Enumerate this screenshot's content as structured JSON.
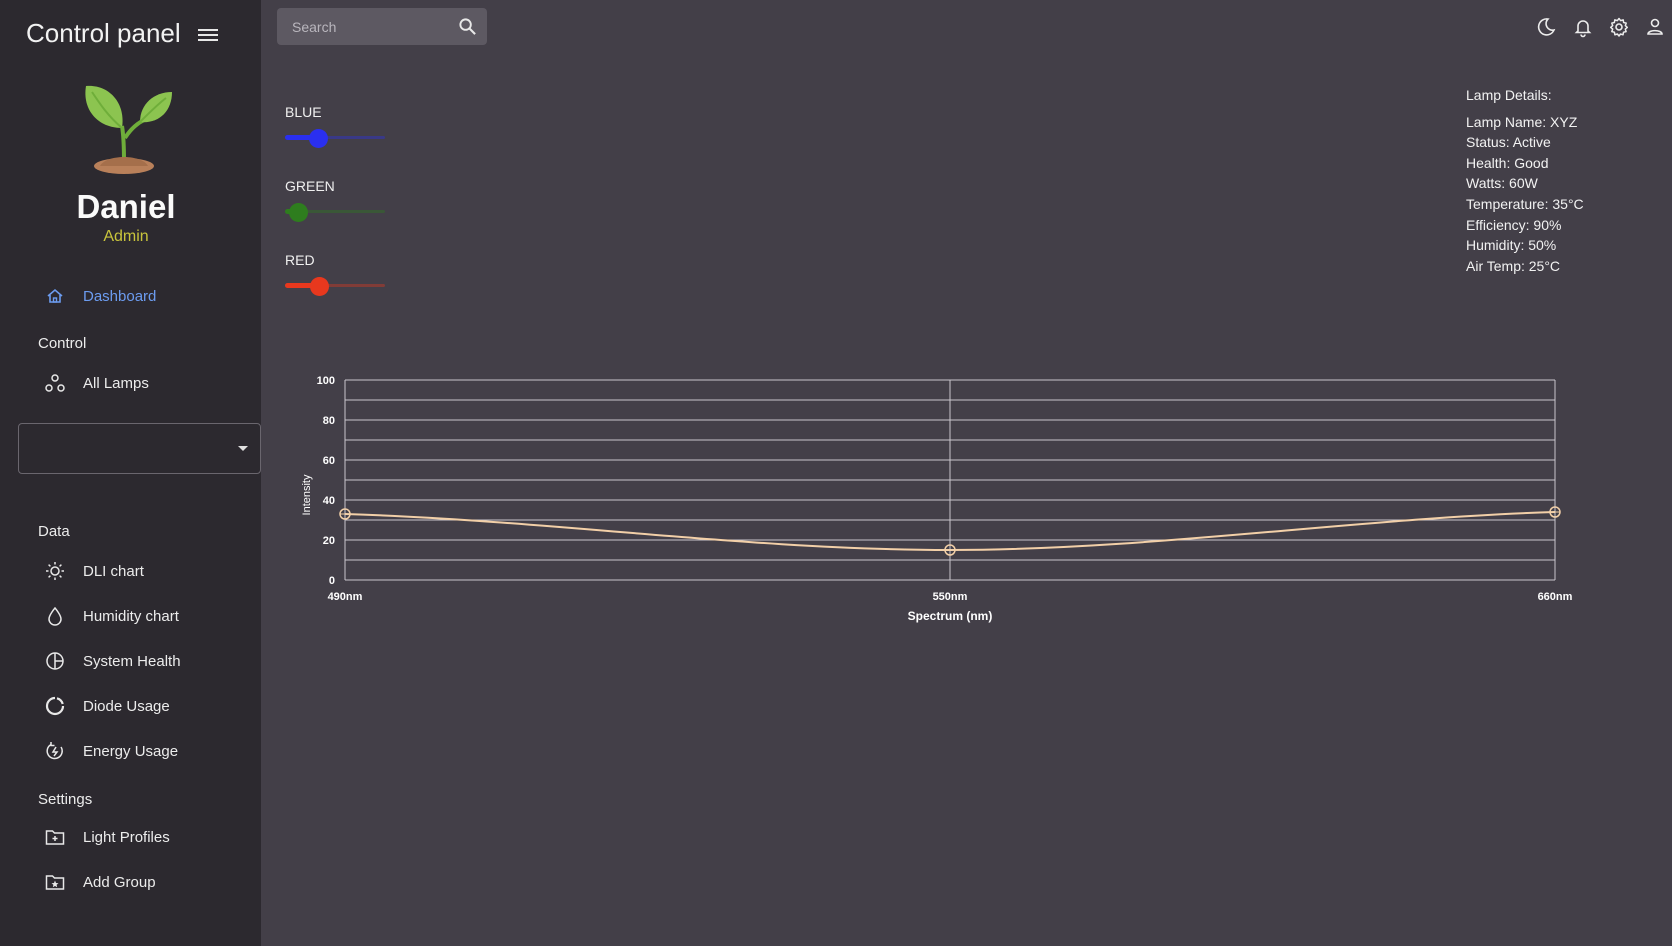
{
  "app": {
    "title": "Control panel"
  },
  "user": {
    "name": "Daniel",
    "role": "Admin"
  },
  "nav": {
    "dashboard": "Dashboard",
    "control_section": "Control",
    "all_lamps": "All Lamps",
    "data_section": "Data",
    "dli_chart": "DLI chart",
    "humidity_chart": "Humidity chart",
    "system_health": "System Health",
    "diode_usage": "Diode Usage",
    "energy_usage": "Energy Usage",
    "settings_section": "Settings",
    "light_profiles": "Light Profiles",
    "add_group": "Add Group",
    "group_select_value": ""
  },
  "search": {
    "placeholder": "Search"
  },
  "sliders": {
    "blue": {
      "label": "BLUE",
      "value": 33,
      "color": "#2a2ff0"
    },
    "green": {
      "label": "GREEN",
      "value": 13,
      "color": "#2e7d1e"
    },
    "red": {
      "label": "RED",
      "value": 34,
      "color": "#e8381e"
    }
  },
  "lamp": {
    "title": "Lamp Details:",
    "name": "Lamp Name: XYZ",
    "status": "Status: Active",
    "health": "Health: Good",
    "watts": "Watts: 60W",
    "temperature": "Temperature: 35°C",
    "efficiency": "Efficiency: 90%",
    "humidity": "Humidity: 50%",
    "air_temp": "Air Temp: 25°C"
  },
  "chart_data": {
    "type": "line",
    "categories": [
      "490nm",
      "550nm",
      "660nm"
    ],
    "values": [
      33,
      15,
      34
    ],
    "xlabel": "Spectrum (nm)",
    "ylabel": "Intensity",
    "ylim": [
      0,
      100
    ],
    "yticks": [
      0,
      20,
      40,
      60,
      80,
      100
    ],
    "grid": true,
    "line_color": "#f3d0a8"
  },
  "colors": {
    "background": "#433f48",
    "sidebar": "#2c292f",
    "accent": "#6c9cf0",
    "role": "#c8c43c"
  }
}
